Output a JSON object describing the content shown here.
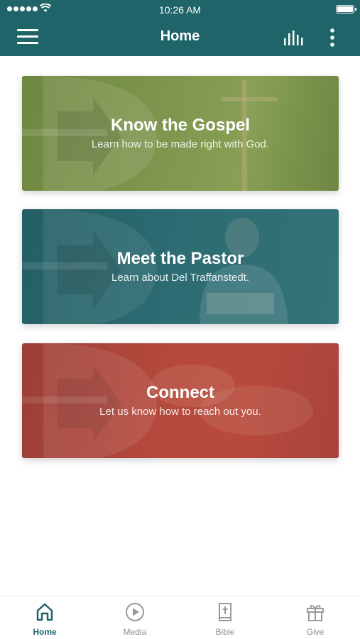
{
  "status_bar": {
    "time": "10:26 AM"
  },
  "header": {
    "title": "Home"
  },
  "cards": [
    {
      "title": "Know the Gospel",
      "subtitle": "Learn how to be made right with God."
    },
    {
      "title": "Meet the Pastor",
      "subtitle": "Learn about Del Traffanstedt."
    },
    {
      "title": "Connect",
      "subtitle": "Let us know how to reach out you."
    }
  ],
  "tabs": [
    {
      "label": "Home",
      "icon": "home-icon",
      "active": true
    },
    {
      "label": "Media",
      "icon": "play-circle-icon",
      "active": false
    },
    {
      "label": "Bible",
      "icon": "bible-icon",
      "active": false
    },
    {
      "label": "Give",
      "icon": "gift-icon",
      "active": false
    }
  ],
  "colors": {
    "header": "#1f6468",
    "card_gospel": "#7c944c",
    "card_pastor": "#2c6c72",
    "card_connect": "#b5493c",
    "tab_active": "#1f6468",
    "tab_inactive": "#8e8e8e"
  }
}
